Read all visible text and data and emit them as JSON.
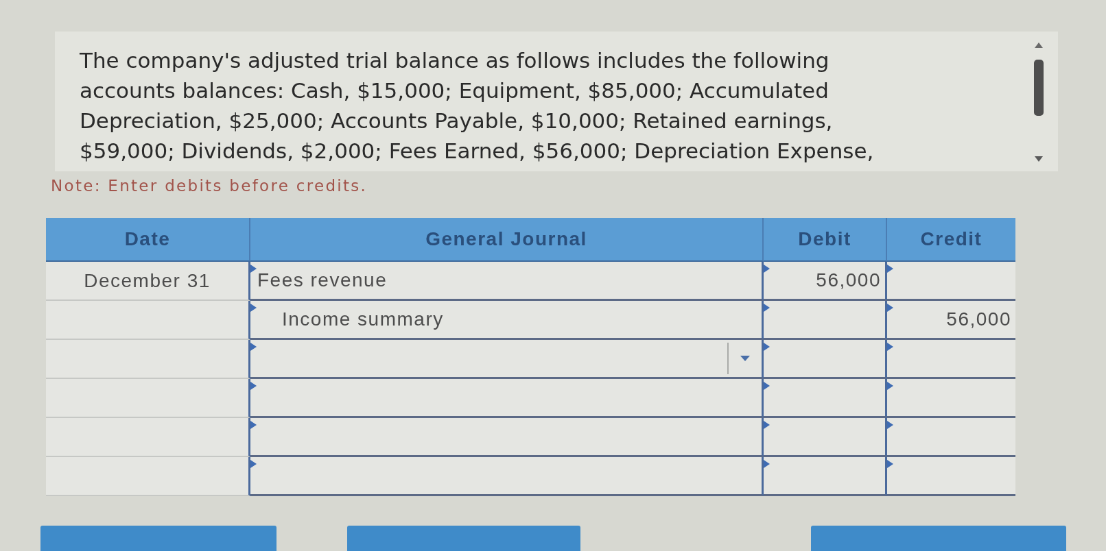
{
  "problem": {
    "text": "The company's adjusted trial balance as follows includes the following accounts balances: Cash, $15,000; Equipment, $85,000; Accumulated Depreciation, $25,000; Accounts Payable, $10,000; Retained earnings, $59,000; Dividends, $2,000; Fees Earned, $56,000; Depreciation Expense,"
  },
  "note": "Note: Enter debits before credits.",
  "journal": {
    "columns": [
      "Date",
      "General Journal",
      "Debit",
      "Credit"
    ],
    "rows": [
      {
        "date": "December 31",
        "account": "Fees revenue",
        "indented": false,
        "dropdown_caret": false,
        "debit": "56,000"
      },
      {
        "account": "Income summary",
        "indented": true,
        "dropdown_caret": false,
        "credit": "56,000"
      },
      {
        "dropdown_caret": true
      },
      {
        "dropdown_caret": false
      },
      {
        "dropdown_caret": false
      },
      {
        "dropdown_caret": false
      }
    ]
  },
  "buttons": [
    {
      "kind": "action"
    },
    {
      "kind": "action"
    },
    {
      "kind": "action"
    }
  ]
}
